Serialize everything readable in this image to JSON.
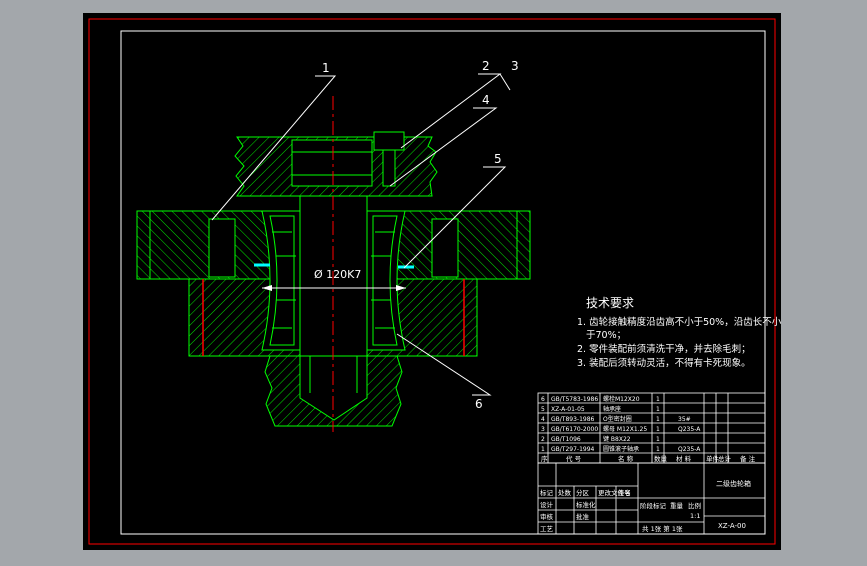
{
  "drawing": {
    "diameter_label": "Ø 120K7",
    "balloons": [
      "1",
      "2",
      "3",
      "4",
      "5",
      "6"
    ],
    "notes": {
      "title": "技术要求",
      "lines": [
        "1. 齿轮接触精度沿齿高不小于50%，沿齿长不小",
        "于70%；",
        "2. 零件装配前须清洗干净，并去除毛刺；",
        "3. 装配后须转动灵活，不得有卡死现象。"
      ]
    },
    "parts_list": [
      {
        "no": "6",
        "code": "GB/T5783-1986",
        "name": "螺栓M12X20"
      },
      {
        "no": "5",
        "code": "XZ-A-01-05",
        "name": "轴承座"
      },
      {
        "no": "4",
        "code": "GB/T893-1986",
        "name": "O型密封圈",
        "spec": "35#"
      },
      {
        "no": "3",
        "code": "GB/T6170-2000",
        "name": "螺母 M12X1.25",
        "spec": "Q235-A"
      },
      {
        "no": "2",
        "code": "GB/T1096",
        "name": "键 B8X22"
      },
      {
        "no": "1",
        "code": "GB/T297-1994",
        "name": "圆锥滚子轴承",
        "spec": "Q235-A"
      }
    ],
    "parts_header": [
      "序",
      "代 号",
      "名 称",
      "数量",
      "材 料",
      "单件",
      "总计",
      "备 注"
    ],
    "title_block": {
      "name": "二级齿轮箱",
      "drawing_no": "XZ-A-00",
      "scale": "1:1",
      "sheet": "共 1张  第 1张",
      "row_labels": [
        "标记",
        "处数",
        "分区",
        "更改文件号",
        "签名",
        "年月日"
      ],
      "sign_labels": [
        "设计",
        "审核",
        "工艺",
        "标准化",
        "批准"
      ],
      "stage_labels": [
        "阶段标记",
        "重量",
        "比例"
      ]
    }
  }
}
